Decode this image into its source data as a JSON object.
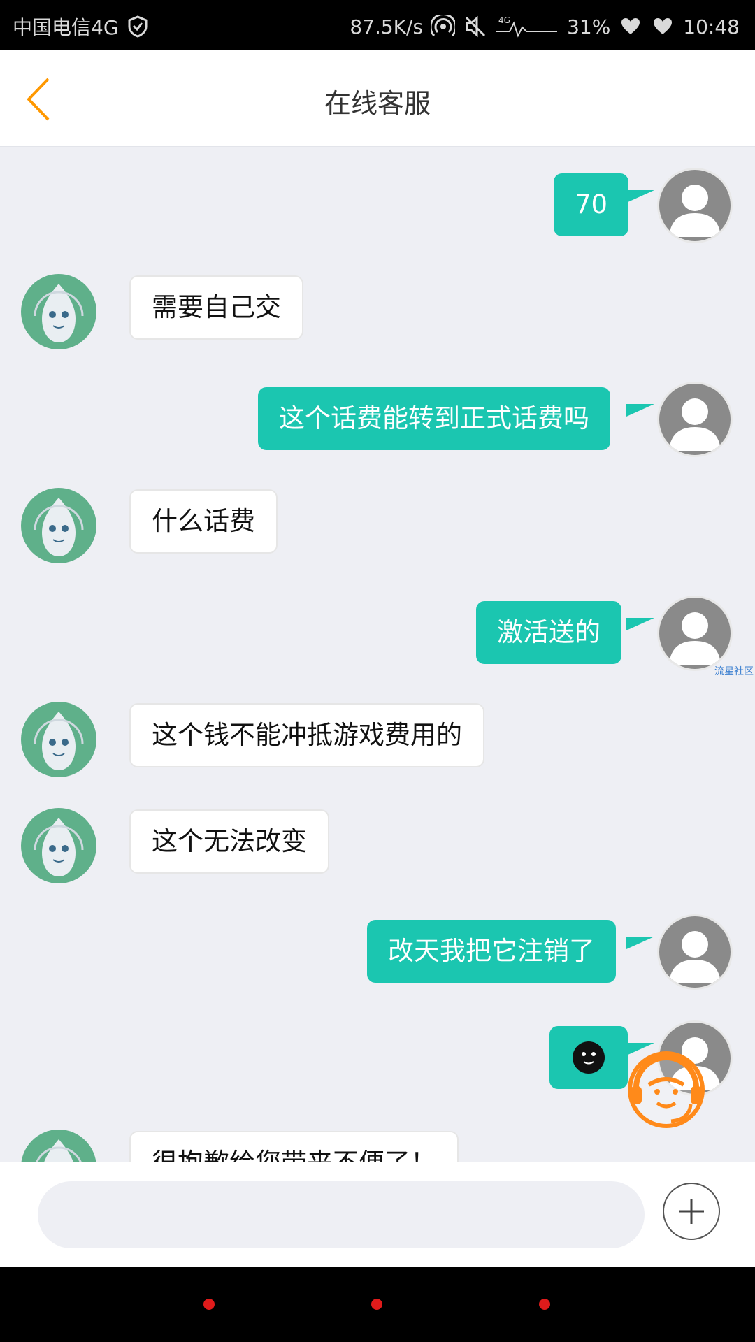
{
  "status_bar": {
    "carrier": "中国电信4G",
    "net_speed": "87.5K/s",
    "battery": "31%",
    "time": "10:48"
  },
  "header": {
    "title": "在线客服"
  },
  "messages": [
    {
      "side": "right",
      "text": "70"
    },
    {
      "side": "left",
      "text": "需要自己交"
    },
    {
      "side": "right",
      "text": "这个话费能转到正式话费吗"
    },
    {
      "side": "left",
      "text": "什么话费"
    },
    {
      "side": "right",
      "text": "激活送的"
    },
    {
      "side": "left",
      "text": "这个钱不能冲抵游戏费用的"
    },
    {
      "side": "left",
      "text": "这个无法改变"
    },
    {
      "side": "right",
      "text": "改天我把它注销了"
    },
    {
      "side": "right",
      "text": "",
      "emoji": "smiley-face-icon"
    },
    {
      "side": "left",
      "text": "很抱歉给您带来不便了！"
    }
  ],
  "watermark": "流星社区",
  "input": {
    "placeholder": ""
  },
  "colors": {
    "accent": "#ff9800",
    "bubble_right": "#1bc6b0",
    "chat_bg": "#eeeff4",
    "nav_dot": "#e01b1b"
  }
}
